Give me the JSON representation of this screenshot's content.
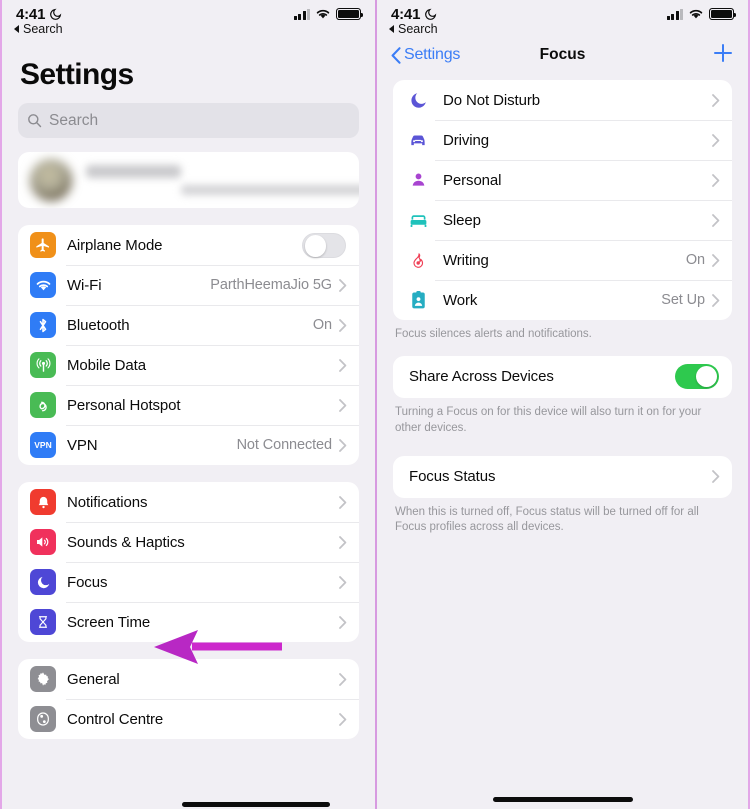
{
  "status_bar": {
    "time": "4:41",
    "focus_moon_icon": "moon-focus-icon",
    "back_label": "Search",
    "signal_icon": "cellular-signal-icon",
    "wifi_icon": "wifi-icon",
    "battery_icon": "battery-full-icon"
  },
  "left_panel": {
    "title": "Settings",
    "search": {
      "placeholder": "Search",
      "icon": "search-icon"
    },
    "account": {
      "name_blurred": "",
      "subtitle_blurred": ""
    },
    "groups": [
      {
        "rows": [
          {
            "label": "Airplane Mode",
            "value": "",
            "icon": "airplane-icon",
            "icon_color": "#f09019",
            "control": "toggle-off"
          },
          {
            "label": "Wi-Fi",
            "value": "ParthHeemaJio 5G",
            "icon": "wifi-icon",
            "icon_color": "#2f7cf6",
            "control": "chevron"
          },
          {
            "label": "Bluetooth",
            "value": "On",
            "icon": "bluetooth-icon",
            "icon_color": "#2f7cf6",
            "control": "chevron"
          },
          {
            "label": "Mobile Data",
            "value": "",
            "icon": "cellular-tower-icon",
            "icon_color": "#49bb55",
            "control": "chevron"
          },
          {
            "label": "Personal Hotspot",
            "value": "",
            "icon": "hotspot-link-icon",
            "icon_color": "#49bb55",
            "control": "chevron"
          },
          {
            "label": "VPN",
            "value": "Not Connected",
            "icon": "vpn-icon",
            "icon_color": "#2f7cf6",
            "control": "chevron"
          }
        ]
      },
      {
        "rows": [
          {
            "label": "Notifications",
            "value": "",
            "icon": "bell-icon",
            "icon_color": "#f03b2f",
            "control": "chevron"
          },
          {
            "label": "Sounds & Haptics",
            "value": "",
            "icon": "speaker-icon",
            "icon_color": "#f0315c",
            "control": "chevron"
          },
          {
            "label": "Focus",
            "value": "",
            "icon": "moon-icon",
            "icon_color": "#4e47d6",
            "control": "chevron"
          },
          {
            "label": "Screen Time",
            "value": "",
            "icon": "hourglass-icon",
            "icon_color": "#4e47d6",
            "control": "chevron"
          }
        ]
      },
      {
        "rows": [
          {
            "label": "General",
            "value": "",
            "icon": "gear-icon",
            "icon_color": "#8e8e93",
            "control": "chevron"
          },
          {
            "label": "Control Centre",
            "value": "",
            "icon": "control-centre-icon",
            "icon_color": "#8e8e93",
            "control": "chevron"
          }
        ]
      }
    ]
  },
  "right_panel": {
    "nav": {
      "back_label": "Settings",
      "title": "Focus",
      "add_icon": "plus-icon",
      "back_icon": "chevron-left-icon"
    },
    "focus_profiles": [
      {
        "label": "Do Not Disturb",
        "value": "",
        "icon": "moon-icon",
        "icon_color": "#5b55d6"
      },
      {
        "label": "Driving",
        "value": "",
        "icon": "car-icon",
        "icon_color": "#5b55d6"
      },
      {
        "label": "Personal",
        "value": "",
        "icon": "person-icon",
        "icon_color": "#a844d0"
      },
      {
        "label": "Sleep",
        "value": "",
        "icon": "bed-icon",
        "icon_color": "#1fc2bb"
      },
      {
        "label": "Writing",
        "value": "On",
        "icon": "flame-icon",
        "icon_color": "#ef4056"
      },
      {
        "label": "Work",
        "value": "Set Up",
        "icon": "id-badge-icon",
        "icon_color": "#26adc2"
      }
    ],
    "focus_footnote": "Focus silences alerts and notifications.",
    "share": {
      "label": "Share Across Devices",
      "toggle_state": "on",
      "footnote": "Turning a Focus on for this device will also turn it on for your other devices."
    },
    "focus_status": {
      "label": "Focus Status",
      "footnote": "When this is turned off, Focus status will be turned off for all Focus profiles across all devices."
    }
  },
  "annotation": {
    "arrow_color": "#cc28cc",
    "arrow_points_to": "Focus"
  },
  "colors": {
    "page_background": "#f1eff4",
    "card_background": "#ffffff",
    "accent_blue": "#3b7df6",
    "toggle_on_green": "#2ec94e",
    "divider_purple": "#e3a7e8"
  }
}
